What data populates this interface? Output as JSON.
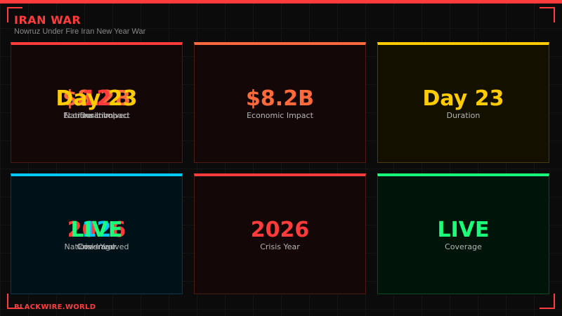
{
  "header": {
    "title": "IRAN WAR",
    "subtitle": "Nowruz Under Fire Iran New Year War"
  },
  "footer": {
    "brand": "BLACKWIRE.WORLD"
  },
  "colors": {
    "accent": "#ff3b3b",
    "orange": "#ff6a3d",
    "yellow": "#ffcc00",
    "cyan": "#00c8ff",
    "green": "#1aff7a"
  },
  "cards": [
    {
      "id": "stack-top",
      "layers": [
        {
          "value": "$8.2B",
          "label": "Economic Impact",
          "color": "#ff6a3d"
        },
        {
          "value": "12",
          "label": "Nations Involved",
          "color": "#ff3b3b"
        },
        {
          "value": "Day 23",
          "label": "Duration",
          "color": "#ffcc00"
        }
      ]
    },
    {
      "id": "economic",
      "value": "$8.2B",
      "label": "Economic Impact",
      "color": "#ff6a3d"
    },
    {
      "id": "duration",
      "value": "Day 23",
      "label": "Duration",
      "color": "#ffcc00"
    },
    {
      "id": "stack-bottom",
      "layers": [
        {
          "value": "2026",
          "label": "Crisis Year",
          "color": "#ff3b3b"
        },
        {
          "value": "12",
          "label": "Nations Involved",
          "color": "#00c8ff"
        },
        {
          "value": "LIVE",
          "label": "Coverage",
          "color": "#1aff7a"
        }
      ]
    },
    {
      "id": "crisis-year",
      "value": "2026",
      "label": "Crisis Year",
      "color": "#ff3b3b"
    },
    {
      "id": "coverage",
      "value": "LIVE",
      "label": "Coverage",
      "color": "#1aff7a"
    }
  ]
}
